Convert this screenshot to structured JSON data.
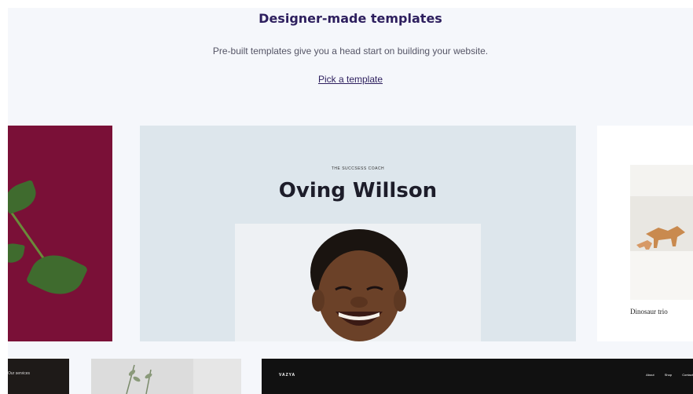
{
  "hero": {
    "title": "Designer-made templates",
    "subtitle": "Pre-built templates give you a head start on building your website.",
    "cta": "Pick a template"
  },
  "templates": {
    "main": {
      "kicker": "THE SUCCSESS COACH",
      "name": "Oving Willson"
    },
    "right": {
      "caption": "Dinosaur trio"
    },
    "bottom_left": {
      "label": "Our services"
    },
    "bottom_right": {
      "brand": "VAZYA",
      "nav": [
        "About",
        "Shop",
        "Contact"
      ]
    }
  },
  "colors": {
    "heading": "#2d1f5e",
    "left_card": "#7a1037",
    "main_card": "#dde6ec",
    "dark_card": "#111111"
  }
}
